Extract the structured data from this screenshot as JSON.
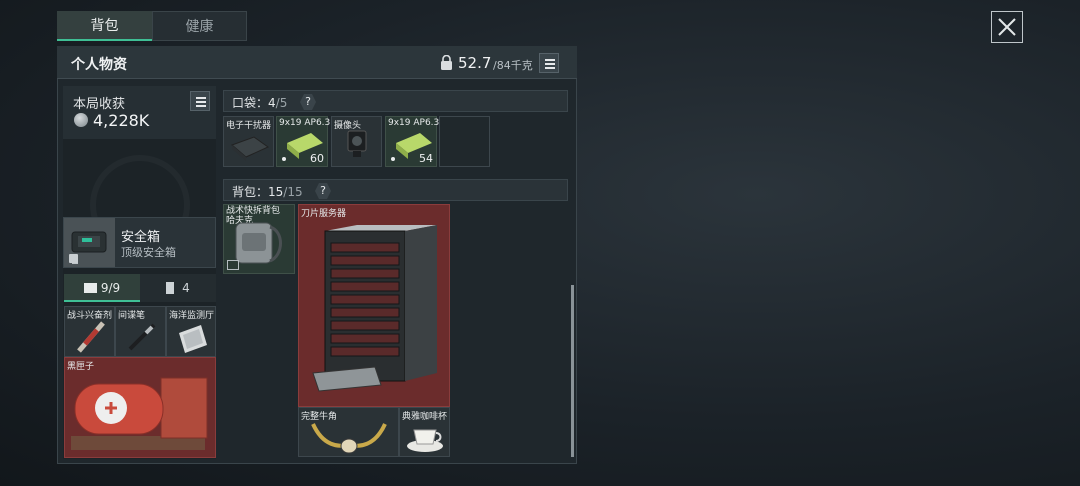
{
  "tabs": {
    "backpack": "背包",
    "health": "健康"
  },
  "panel": {
    "title": "个人物资",
    "weight_current": "52.7",
    "weight_max": "/84千克"
  },
  "income": {
    "label": "本局收获",
    "value": "4,228K"
  },
  "safe_box": {
    "title": "安全箱",
    "subtitle": "顶级安全箱"
  },
  "sub_tabs": {
    "medkit": "9/9",
    "clip": "4"
  },
  "safe_items": [
    {
      "name": "战斗兴奋剂"
    },
    {
      "name": "间谍笔"
    },
    {
      "name": "海洋监测厅"
    },
    {
      "name": "黑匣子"
    }
  ],
  "pockets": {
    "label": "口袋：",
    "count": "4",
    "capacity": "/5",
    "help": "?",
    "items": [
      {
        "name": "电子干扰器",
        "count": ""
      },
      {
        "name": "9x19 AP6.3",
        "count": "60"
      },
      {
        "name": "摄像头",
        "count": ""
      },
      {
        "name": "9x19 AP6.3",
        "count": "54"
      }
    ]
  },
  "backpack": {
    "label": "背包：",
    "count": "15",
    "capacity": "/15",
    "help": "?",
    "items": [
      {
        "name": "战术快拆背包 哈夫克"
      },
      {
        "name": "刀片服务器"
      },
      {
        "name": "完整牛角"
      },
      {
        "name": "典雅咖啡杯"
      }
    ]
  },
  "colors": {
    "accent": "#3fbf95",
    "rare_red": "#6b2c2c",
    "panel": "#1f272c"
  }
}
